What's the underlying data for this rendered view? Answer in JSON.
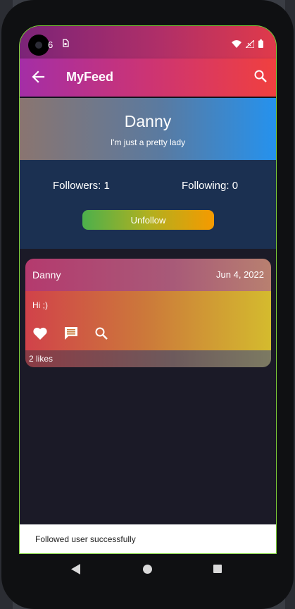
{
  "status_bar": {
    "time": "6",
    "sim_icon": "sim-card-icon",
    "icons": [
      "wifi-icon",
      "signal-icon",
      "battery-icon"
    ]
  },
  "app_bar": {
    "title": "MyFeed",
    "back_icon": "arrow-back-icon",
    "search_icon": "search-icon"
  },
  "profile": {
    "name": "Danny",
    "bio": "I'm just a pretty lady",
    "followers": "Followers: 1",
    "following": "Following: 0",
    "unfollow_label": "Unfollow"
  },
  "post": {
    "author": "Danny",
    "date": "Jun 4, 2022",
    "text": "Hi ;)",
    "actions": [
      "heart-icon",
      "comment-icon",
      "search-icon"
    ],
    "likes": "2 likes"
  },
  "snackbar": {
    "message": "Followed user successfully"
  },
  "colors": {
    "app_bar_gradient": [
      "#a42ea6",
      "#f0403f"
    ],
    "header_gradient": [
      "#8a7570",
      "#2592ee"
    ],
    "stats_bg": "#1b3051",
    "screen_bg": "#1b1a27",
    "unfollow_gradient": [
      "#4cb04c",
      "#f59a00"
    ]
  }
}
